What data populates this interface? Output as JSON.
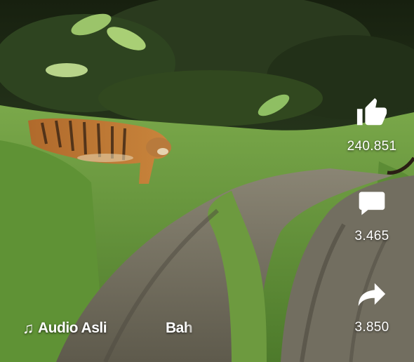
{
  "video": {
    "subject": "tiger-on-forest-road"
  },
  "actions": {
    "like": {
      "icon": "thumbs-up-icon",
      "count": "240.851"
    },
    "comment": {
      "icon": "comment-icon",
      "count": "3.465"
    },
    "share": {
      "icon": "share-arrow-icon",
      "count": "3.850"
    }
  },
  "audio": {
    "icon": "music-note-icon",
    "label": "Audio Asli",
    "scrolling_text": "Bah"
  },
  "colors": {
    "icon": "#ffffff",
    "text": "#ffffff"
  }
}
